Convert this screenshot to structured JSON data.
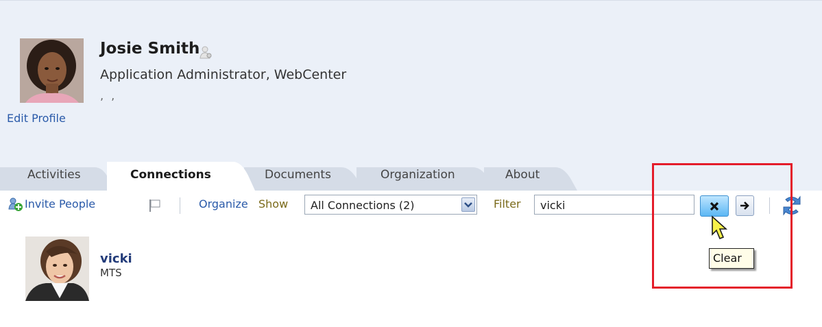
{
  "profile": {
    "name": "Josie Smith",
    "title": "Application Administrator, WebCenter",
    "dots": ", ,",
    "edit_profile": "Edit Profile"
  },
  "tabs": [
    {
      "label": "Activities",
      "active": false
    },
    {
      "label": "Connections",
      "active": true
    },
    {
      "label": "Documents",
      "active": false
    },
    {
      "label": "Organization",
      "active": false
    },
    {
      "label": "About",
      "active": false
    }
  ],
  "toolbar": {
    "invite_label": "Invite People",
    "organize_label": "Organize",
    "show_label": "Show",
    "show_selected": "All Connections (2)",
    "filter_label": "Filter",
    "filter_value": "vicki"
  },
  "tooltip": {
    "text": "Clear"
  },
  "connections": [
    {
      "name": "vicki",
      "role": "MTS"
    }
  ],
  "colors": {
    "header_bg": "#ebf0f8",
    "link": "#2a5aa9",
    "highlight_box": "#e41c2a",
    "clear_button": "#5bb7f4"
  }
}
